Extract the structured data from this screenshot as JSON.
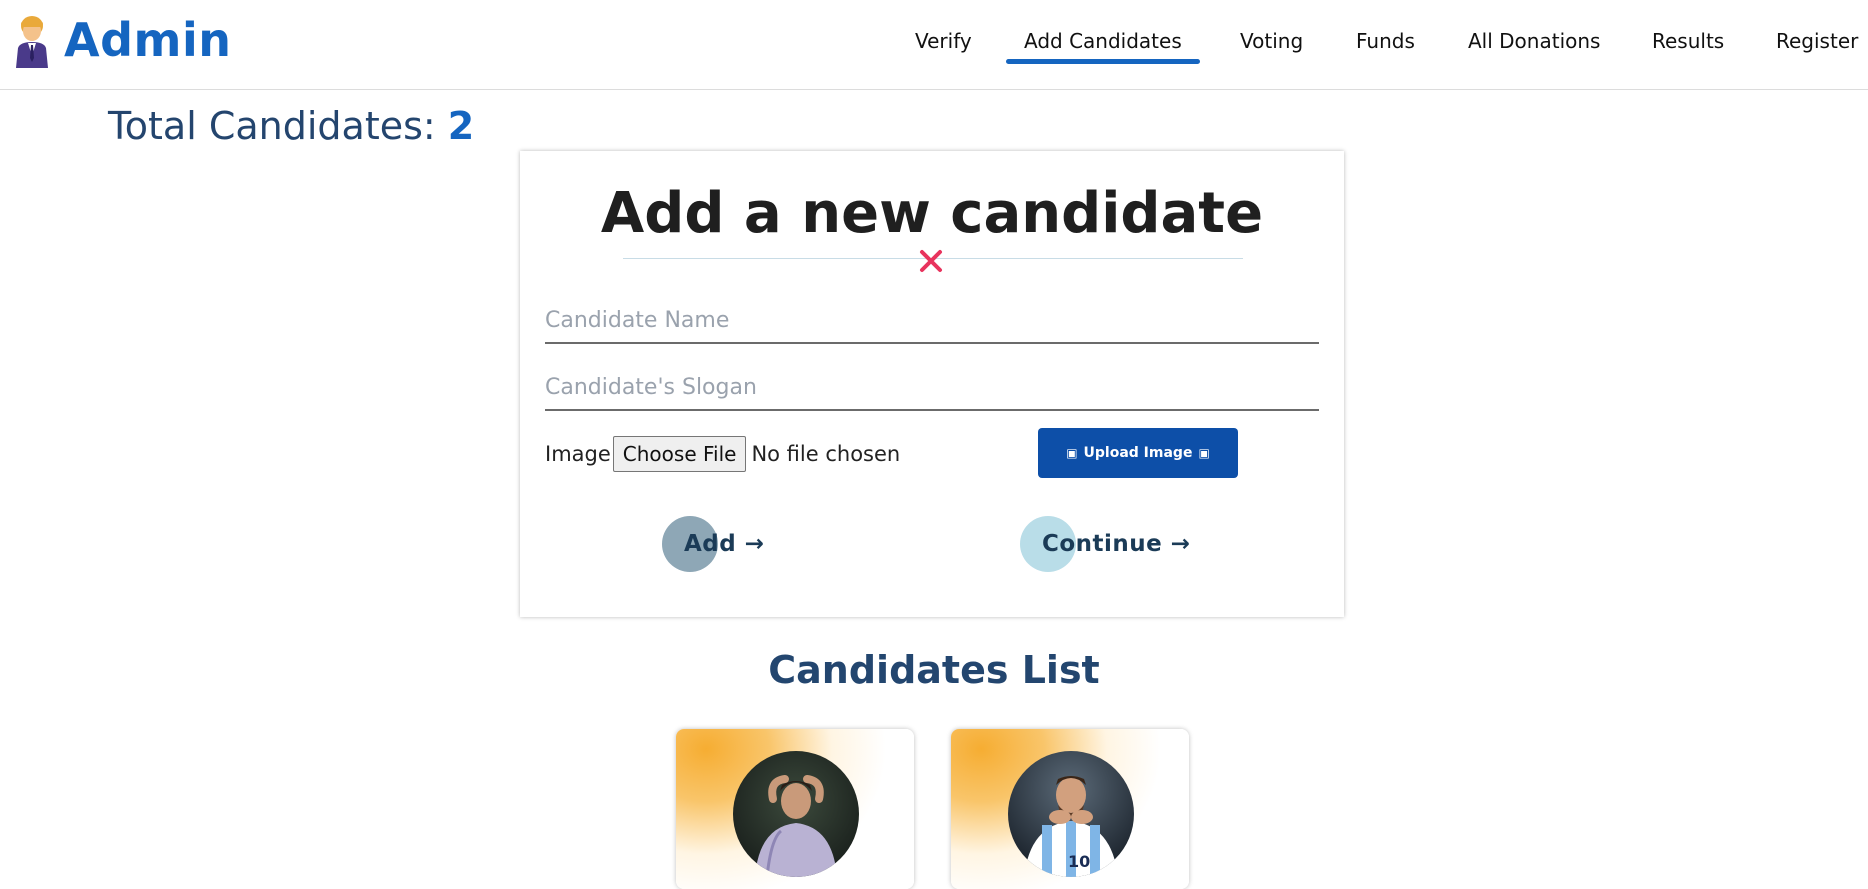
{
  "header": {
    "app_title": "Admin",
    "nav": [
      "Verify",
      "Add Candidates",
      "Voting",
      "Funds",
      "All Donations",
      "Results",
      "Register"
    ],
    "active_nav": "Add Candidates"
  },
  "total": {
    "label": "Total Candidates:",
    "value": "2"
  },
  "form": {
    "title": "Add a new candidate",
    "name_placeholder": "Candidate Name",
    "slogan_placeholder": "Candidate's Slogan",
    "image_label": "Image",
    "choose_file_label": "Choose File",
    "no_file_label": "No file chosen",
    "upload_label": "Upload Image",
    "add_label": "Add →",
    "continue_label": "Continue →"
  },
  "list": {
    "title": "Candidates List"
  },
  "colors": {
    "brand": "#1565c0",
    "heading": "#23466f",
    "upload_button": "#0d4fa8",
    "close_icon": "#e8335d",
    "add_bubble": "#8ea7b6",
    "continue_bubble": "#b9dde8",
    "card_gradient": "#f6ad32"
  },
  "icons": {
    "logo": "businessman-icon",
    "close": "close-icon",
    "upload": "upload-icon"
  }
}
